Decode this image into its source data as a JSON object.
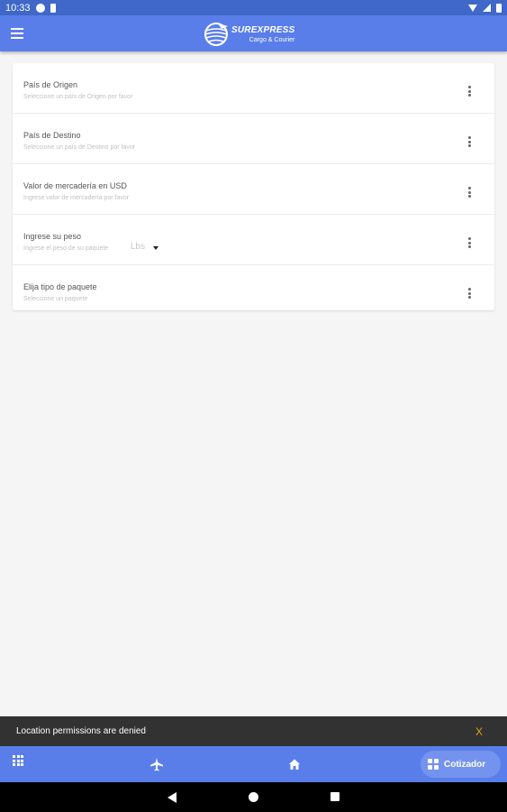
{
  "status_bar": {
    "time": "10:33",
    "icons": [
      "sync-icon",
      "sim-card-icon",
      "wifi-icon",
      "signal-icon",
      "battery-icon"
    ]
  },
  "app_bar": {
    "logo_name": "SUREXPRESS",
    "logo_subtitle": "Cargo & Courier",
    "icons": [
      "menu-icon",
      "globe-logo-icon"
    ]
  },
  "form": {
    "fields": [
      {
        "label": "País de Origen",
        "hint": "Seleccione un país de Origen por favor"
      },
      {
        "label": "País de Destino",
        "hint": "Seleccione un país de Destino por favor"
      },
      {
        "label": "Valor de mercadería en USD",
        "hint": "Ingrese valor de mercadería por favor"
      },
      {
        "label": "Ingrese su peso",
        "hint": "Ingrese el peso de su paquete",
        "unit": "Lbs"
      },
      {
        "label": "Elija tipo de paquete",
        "hint": "Seleccione un paquete"
      }
    ]
  },
  "snackbar": {
    "message": "Location permissions are denied",
    "dismiss": "X",
    "dismiss_color": "#d8a21a"
  },
  "bottom_nav": {
    "items": [
      "grid-icon",
      "plane-icon",
      "home-icon"
    ],
    "active_label": "Cotizador",
    "active_icon": "calculator-icon"
  },
  "system_nav": [
    "back-icon",
    "home-circle-icon",
    "recents-icon"
  ],
  "colors": {
    "primary": "#5a7ee9",
    "status_bar": "#3f68c8",
    "background": "#f5f5f5",
    "snackbar": "#323232"
  }
}
